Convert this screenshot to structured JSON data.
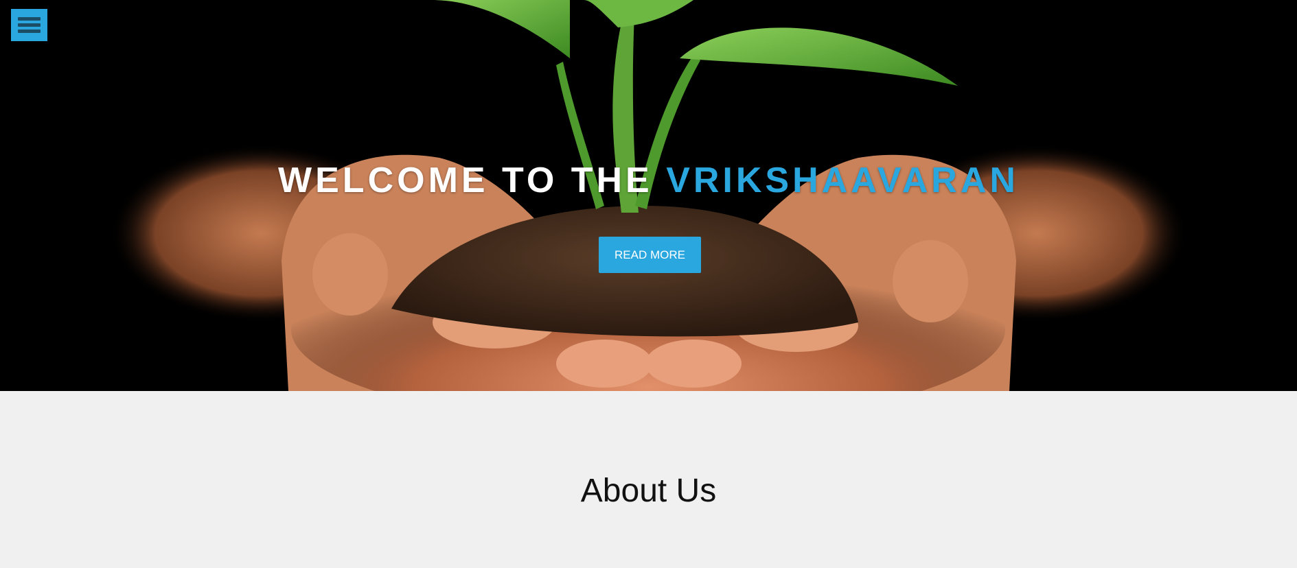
{
  "nav": {
    "menu_icon": "hamburger-menu-icon"
  },
  "hero": {
    "title_prefix": "WELCOME TO THE ",
    "title_highlight": "VRIKSHAAVARAN",
    "read_more_label": "READ MORE",
    "image_subject": "seedling-in-soil-in-cupped-hands"
  },
  "about": {
    "heading": "About Us"
  },
  "colors": {
    "accent": "#2aa7df",
    "hero_background": "#000000",
    "page_background": "#f0f0f0",
    "menu_icon_bars": "#1c4d66"
  }
}
